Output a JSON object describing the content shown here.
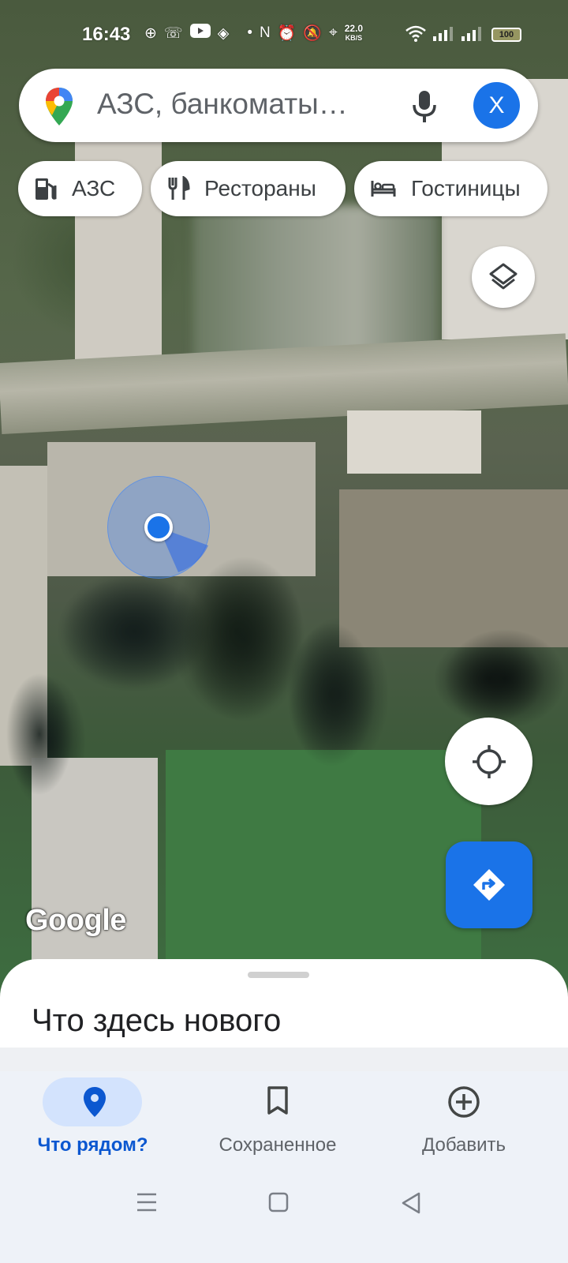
{
  "status_bar": {
    "time": "16:43",
    "speed_value": "22.0",
    "speed_unit": "KB/S",
    "battery": "100"
  },
  "search": {
    "placeholder": "АЗС, банкоматы…",
    "avatar_letter": "Х"
  },
  "chips": [
    {
      "label": "АЗС",
      "icon": "gas-station-icon"
    },
    {
      "label": "Рестораны",
      "icon": "restaurant-icon"
    },
    {
      "label": "Гостиницы",
      "icon": "hotel-icon"
    }
  ],
  "map": {
    "attribution": "Google"
  },
  "sheet": {
    "title": "Что здесь нового"
  },
  "nav": {
    "items": [
      {
        "label": "Что рядом?",
        "icon": "place-icon",
        "active": true
      },
      {
        "label": "Сохраненное",
        "icon": "bookmark-icon",
        "active": false
      },
      {
        "label": "Добавить",
        "icon": "add-circle-icon",
        "active": false
      }
    ]
  },
  "colors": {
    "accent": "#1a73e8",
    "active_nav": "#0b57d0",
    "active_pill": "#d3e3fd"
  }
}
